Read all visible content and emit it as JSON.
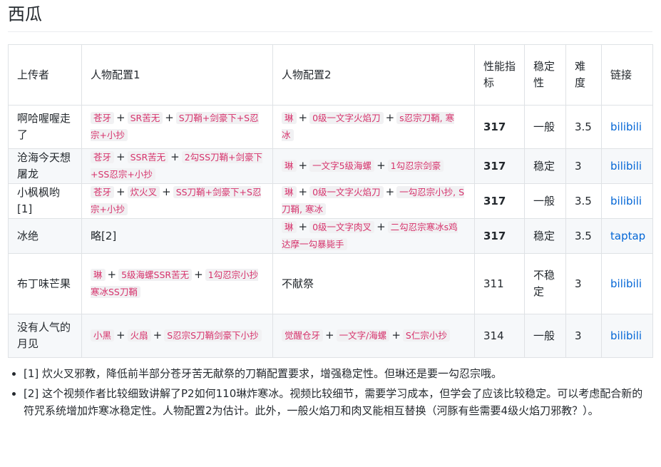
{
  "title": "西瓜",
  "headers": [
    "上传者",
    "人物配置1",
    "人物配置2",
    "性能指标",
    "稳定性",
    "难度",
    "链接"
  ],
  "rows": [
    {
      "uploader": "啊哈喔喔走了",
      "config1": [
        "苍牙",
        "SR苦无",
        "S刀鞘+剑豪下+S忍宗+小抄"
      ],
      "config2": [
        "琳",
        "0级一文字火焰刀",
        "s忍宗刀鞘, 寒冰"
      ],
      "score": "317",
      "score_bold": true,
      "stability": "一般",
      "difficulty": "3.5",
      "link": "bilibili"
    },
    {
      "uploader": "沧海今天想屠龙",
      "config1": [
        "苍牙",
        "SSR苦无",
        "2勾SS刀鞘+剑豪下+SS忍宗+小抄"
      ],
      "config2": [
        "琳",
        "一文字5级海螺",
        "1勾忍宗剑豪"
      ],
      "score": "317",
      "score_bold": true,
      "stability": "稳定",
      "difficulty": "3",
      "link": "bilibili"
    },
    {
      "uploader": "小枫枫哟[1]",
      "config1": [
        "苍牙",
        "炊火叉",
        "SS刀鞘+剑豪下+S忍宗+小抄"
      ],
      "config2": [
        "琳",
        "0级一文字火焰刀",
        "一勾忍宗小抄, S刀鞘, 寒冰"
      ],
      "score": "317",
      "score_bold": true,
      "stability": "一般",
      "difficulty": "3.5",
      "link": "bilibili"
    },
    {
      "uploader": "冰绝",
      "config1_text": "略[2]",
      "config2": [
        "琳",
        "0级一文字肉叉",
        "二勾忍宗寒冰s鸡达摩一勾暴毙手"
      ],
      "score": "317",
      "score_bold": true,
      "stability": "稳定",
      "difficulty": "3.5",
      "link": "taptap"
    },
    {
      "uploader": "布丁味芒果",
      "config1": [
        "琳",
        "5级海螺SSR苦无",
        "1勾忍宗小抄寒冰SS刀鞘"
      ],
      "config2_text": "不献祭",
      "score": "311",
      "score_bold": false,
      "stability": "不稳定",
      "difficulty": "3",
      "link": "bilibili"
    },
    {
      "uploader": "没有人气的月见",
      "config1": [
        "小黑",
        "火扇",
        "S忍宗S刀鞘剑豪下小抄"
      ],
      "config2": [
        "觉醒仓牙",
        "一文字/海螺",
        "S仁宗小抄"
      ],
      "score": "314",
      "score_bold": false,
      "stability": "一般",
      "difficulty": "3",
      "link": "bilibili"
    }
  ],
  "notes": [
    "[1] 炊火叉邪教，降低前半部分苍牙苦无献祭的刀鞘配置要求，增强稳定性。但琳还是要一勾忍宗哦。",
    "[2] 这个视频作者比较细致讲解了P2如何110琳炸寒冰。视频比较细节，需要学习成本，但学会了应该比较稳定。可以考虑配合新的符咒系统增加炸寒冰稳定性。人物配置2为估计。此外，一般火焰刀和肉叉能相互替换（河豚有些需要4级火焰刀邪教？）。"
  ],
  "colors": {
    "link": "#0366d6",
    "code": "#d6336c",
    "border": "#dfe2e5",
    "stripe": "#f6f8fa"
  }
}
